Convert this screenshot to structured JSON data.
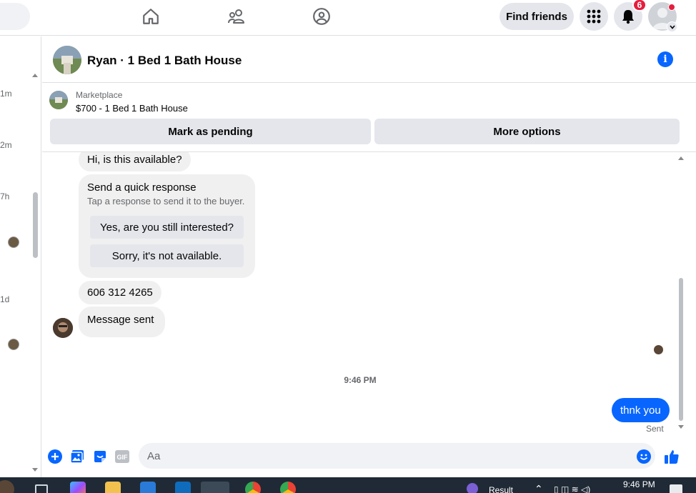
{
  "topbar": {
    "find_friends_label": "Find friends",
    "notification_count": "6",
    "nav_icons": [
      "home-icon",
      "friends-icon",
      "groups-icon"
    ]
  },
  "sidebar": {
    "times": [
      "1m",
      "2m",
      "7h",
      "1d"
    ]
  },
  "chat": {
    "title": "Ryan · 1 Bed 1 Bath House",
    "marketplace_label": "Marketplace",
    "listing": "$700 - 1 Bed 1 Bath House",
    "mark_pending_label": "Mark as pending",
    "more_options_label": "More options"
  },
  "messages": {
    "first": "Hi, is this available?",
    "quick_title": "Send a quick response",
    "quick_sub": "Tap a response to send it to the buyer.",
    "quick_options": [
      "Yes, are you still interested?",
      "Sorry, it's not available."
    ],
    "phone": "606 312 4265",
    "message_sent": "Message sent",
    "timestamp": "9:46 PM",
    "outgoing": "thnk you",
    "status": "Sent"
  },
  "composer": {
    "placeholder": "Aa"
  },
  "taskbar": {
    "result_label": "Result",
    "clock": "9:46 PM"
  },
  "colors": {
    "accent": "#0866ff",
    "badge": "#e41e3f",
    "bubble_in": "#f0f0f0",
    "button_gray": "#e4e6eb"
  }
}
